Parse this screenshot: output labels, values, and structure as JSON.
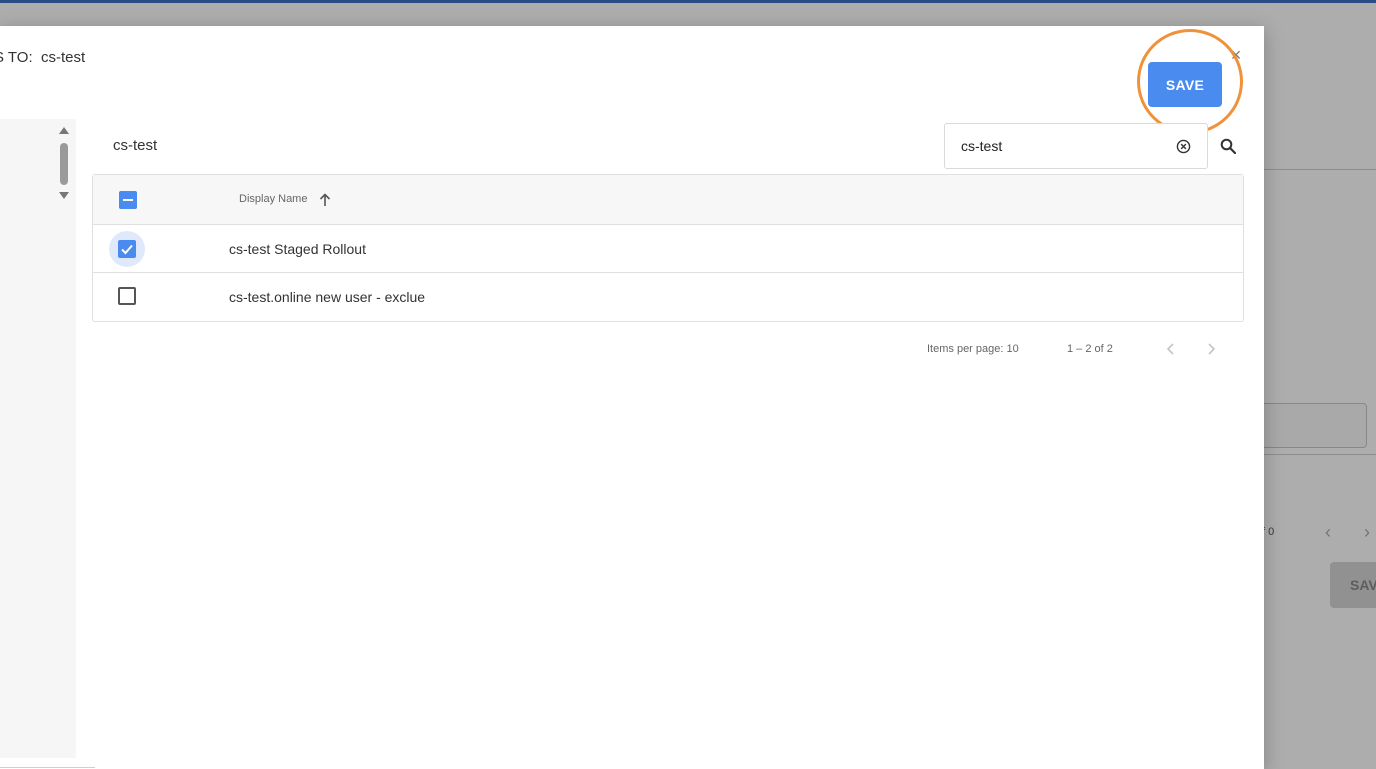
{
  "background": {
    "pager_text": "f 0",
    "save_label": "SAV"
  },
  "dialog": {
    "title_prefix": "S TO:",
    "title_value": "cs-test",
    "save_label": "SAVE",
    "close_glyph": "×"
  },
  "group": {
    "title": "cs-test"
  },
  "search": {
    "value": "cs-test"
  },
  "table": {
    "header": {
      "display_name": "Display Name"
    },
    "rows": [
      {
        "name": "cs-test Staged Rollout",
        "checked": true
      },
      {
        "name": "cs-test.online new user - exclue",
        "checked": false
      }
    ]
  },
  "paginator": {
    "items_per_page_label": "Items per page: 10",
    "range_label": "1 – 2 of 2"
  },
  "colors": {
    "accent": "#4a8bf0",
    "highlight_ring": "#f0923a",
    "top_bar": "#3f6fc4"
  }
}
